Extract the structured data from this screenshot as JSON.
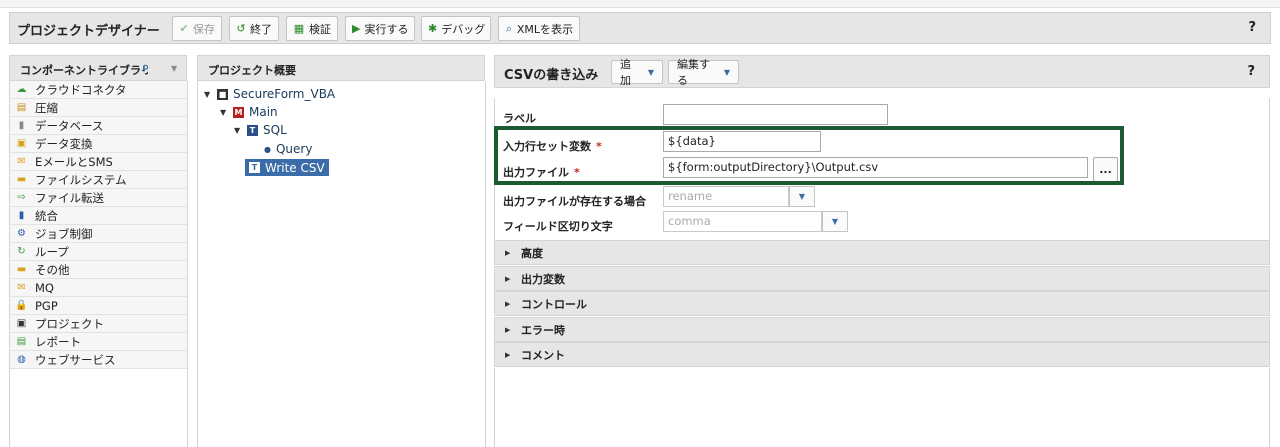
{
  "toolbar": {
    "title": "プロジェクトデザイナー",
    "buttons": {
      "save": "保存",
      "close": "終了",
      "validate": "検証",
      "run": "実行する",
      "debug": "デバッグ",
      "show_xml": "XMLを表示"
    },
    "help": "?"
  },
  "library": {
    "title": "コンポーネントライブラリ",
    "items": [
      {
        "label": "クラウドコネクタ",
        "icon": "cloud-icon",
        "glyph": "☁",
        "color": "#3c9b3c"
      },
      {
        "label": "圧縮",
        "icon": "compress-icon",
        "glyph": "▤",
        "color": "#c9891e"
      },
      {
        "label": "データベース",
        "icon": "database-icon",
        "glyph": "▮",
        "color": "#888888"
      },
      {
        "label": "データ変換",
        "icon": "transform-icon",
        "glyph": "▣",
        "color": "#d9a11e"
      },
      {
        "label": "EメールとSMS",
        "icon": "email-icon",
        "glyph": "✉",
        "color": "#e0a020"
      },
      {
        "label": "ファイルシステム",
        "icon": "folder-icon",
        "glyph": "▬",
        "color": "#d9a11e"
      },
      {
        "label": "ファイル転送",
        "icon": "file-transfer-icon",
        "glyph": "⇨",
        "color": "#3c9b3c"
      },
      {
        "label": "統合",
        "icon": "integration-icon",
        "glyph": "▮",
        "color": "#2a5ea8"
      },
      {
        "label": "ジョブ制御",
        "icon": "gear-icon",
        "glyph": "⚙",
        "color": "#2a5ea8"
      },
      {
        "label": "ループ",
        "icon": "loop-icon",
        "glyph": "↻",
        "color": "#3c9b3c"
      },
      {
        "label": "その他",
        "icon": "misc-folder-icon",
        "glyph": "▬",
        "color": "#d9a11e"
      },
      {
        "label": "MQ",
        "icon": "mq-icon",
        "glyph": "✉",
        "color": "#d9a11e"
      },
      {
        "label": "PGP",
        "icon": "lock-icon",
        "glyph": "🔒",
        "color": "#3c9b3c"
      },
      {
        "label": "プロジェクト",
        "icon": "project-icon",
        "glyph": "▣",
        "color": "#333333"
      },
      {
        "label": "レポート",
        "icon": "report-icon",
        "glyph": "▤",
        "color": "#3c9b3c"
      },
      {
        "label": "ウェブサービス",
        "icon": "web-service-icon",
        "glyph": "◍",
        "color": "#2a5ea8"
      }
    ]
  },
  "overview": {
    "title": "プロジェクト概要",
    "tree": {
      "root": "SecureForm_VBA",
      "main": "Main",
      "sql": "SQL",
      "query": "Query",
      "write_csv": "Write CSV"
    }
  },
  "editor": {
    "title": "CSVの書き込み",
    "add": "追加",
    "edit": "編集する",
    "help": "?",
    "fields": {
      "label_label": "ラベル",
      "label_value": "",
      "input_var_label": "入力行セット変数",
      "input_var_value": "${data}",
      "output_file_label": "出力ファイル",
      "output_file_value": "${form:outputDirectory}\\Output.csv",
      "browse": "...",
      "exists_label": "出力ファイルが存在する場合",
      "exists_placeholder": "rename",
      "delimiter_label": "フィールド区切り文字",
      "delimiter_placeholder": "comma",
      "required_mark": "*"
    },
    "sections": [
      "高度",
      "出力変数",
      "コントロール",
      "エラー時",
      "コメント"
    ]
  },
  "colors": {
    "highlight": "#1c5a32",
    "selection": "#3a6da8",
    "required": "#c0281e"
  }
}
